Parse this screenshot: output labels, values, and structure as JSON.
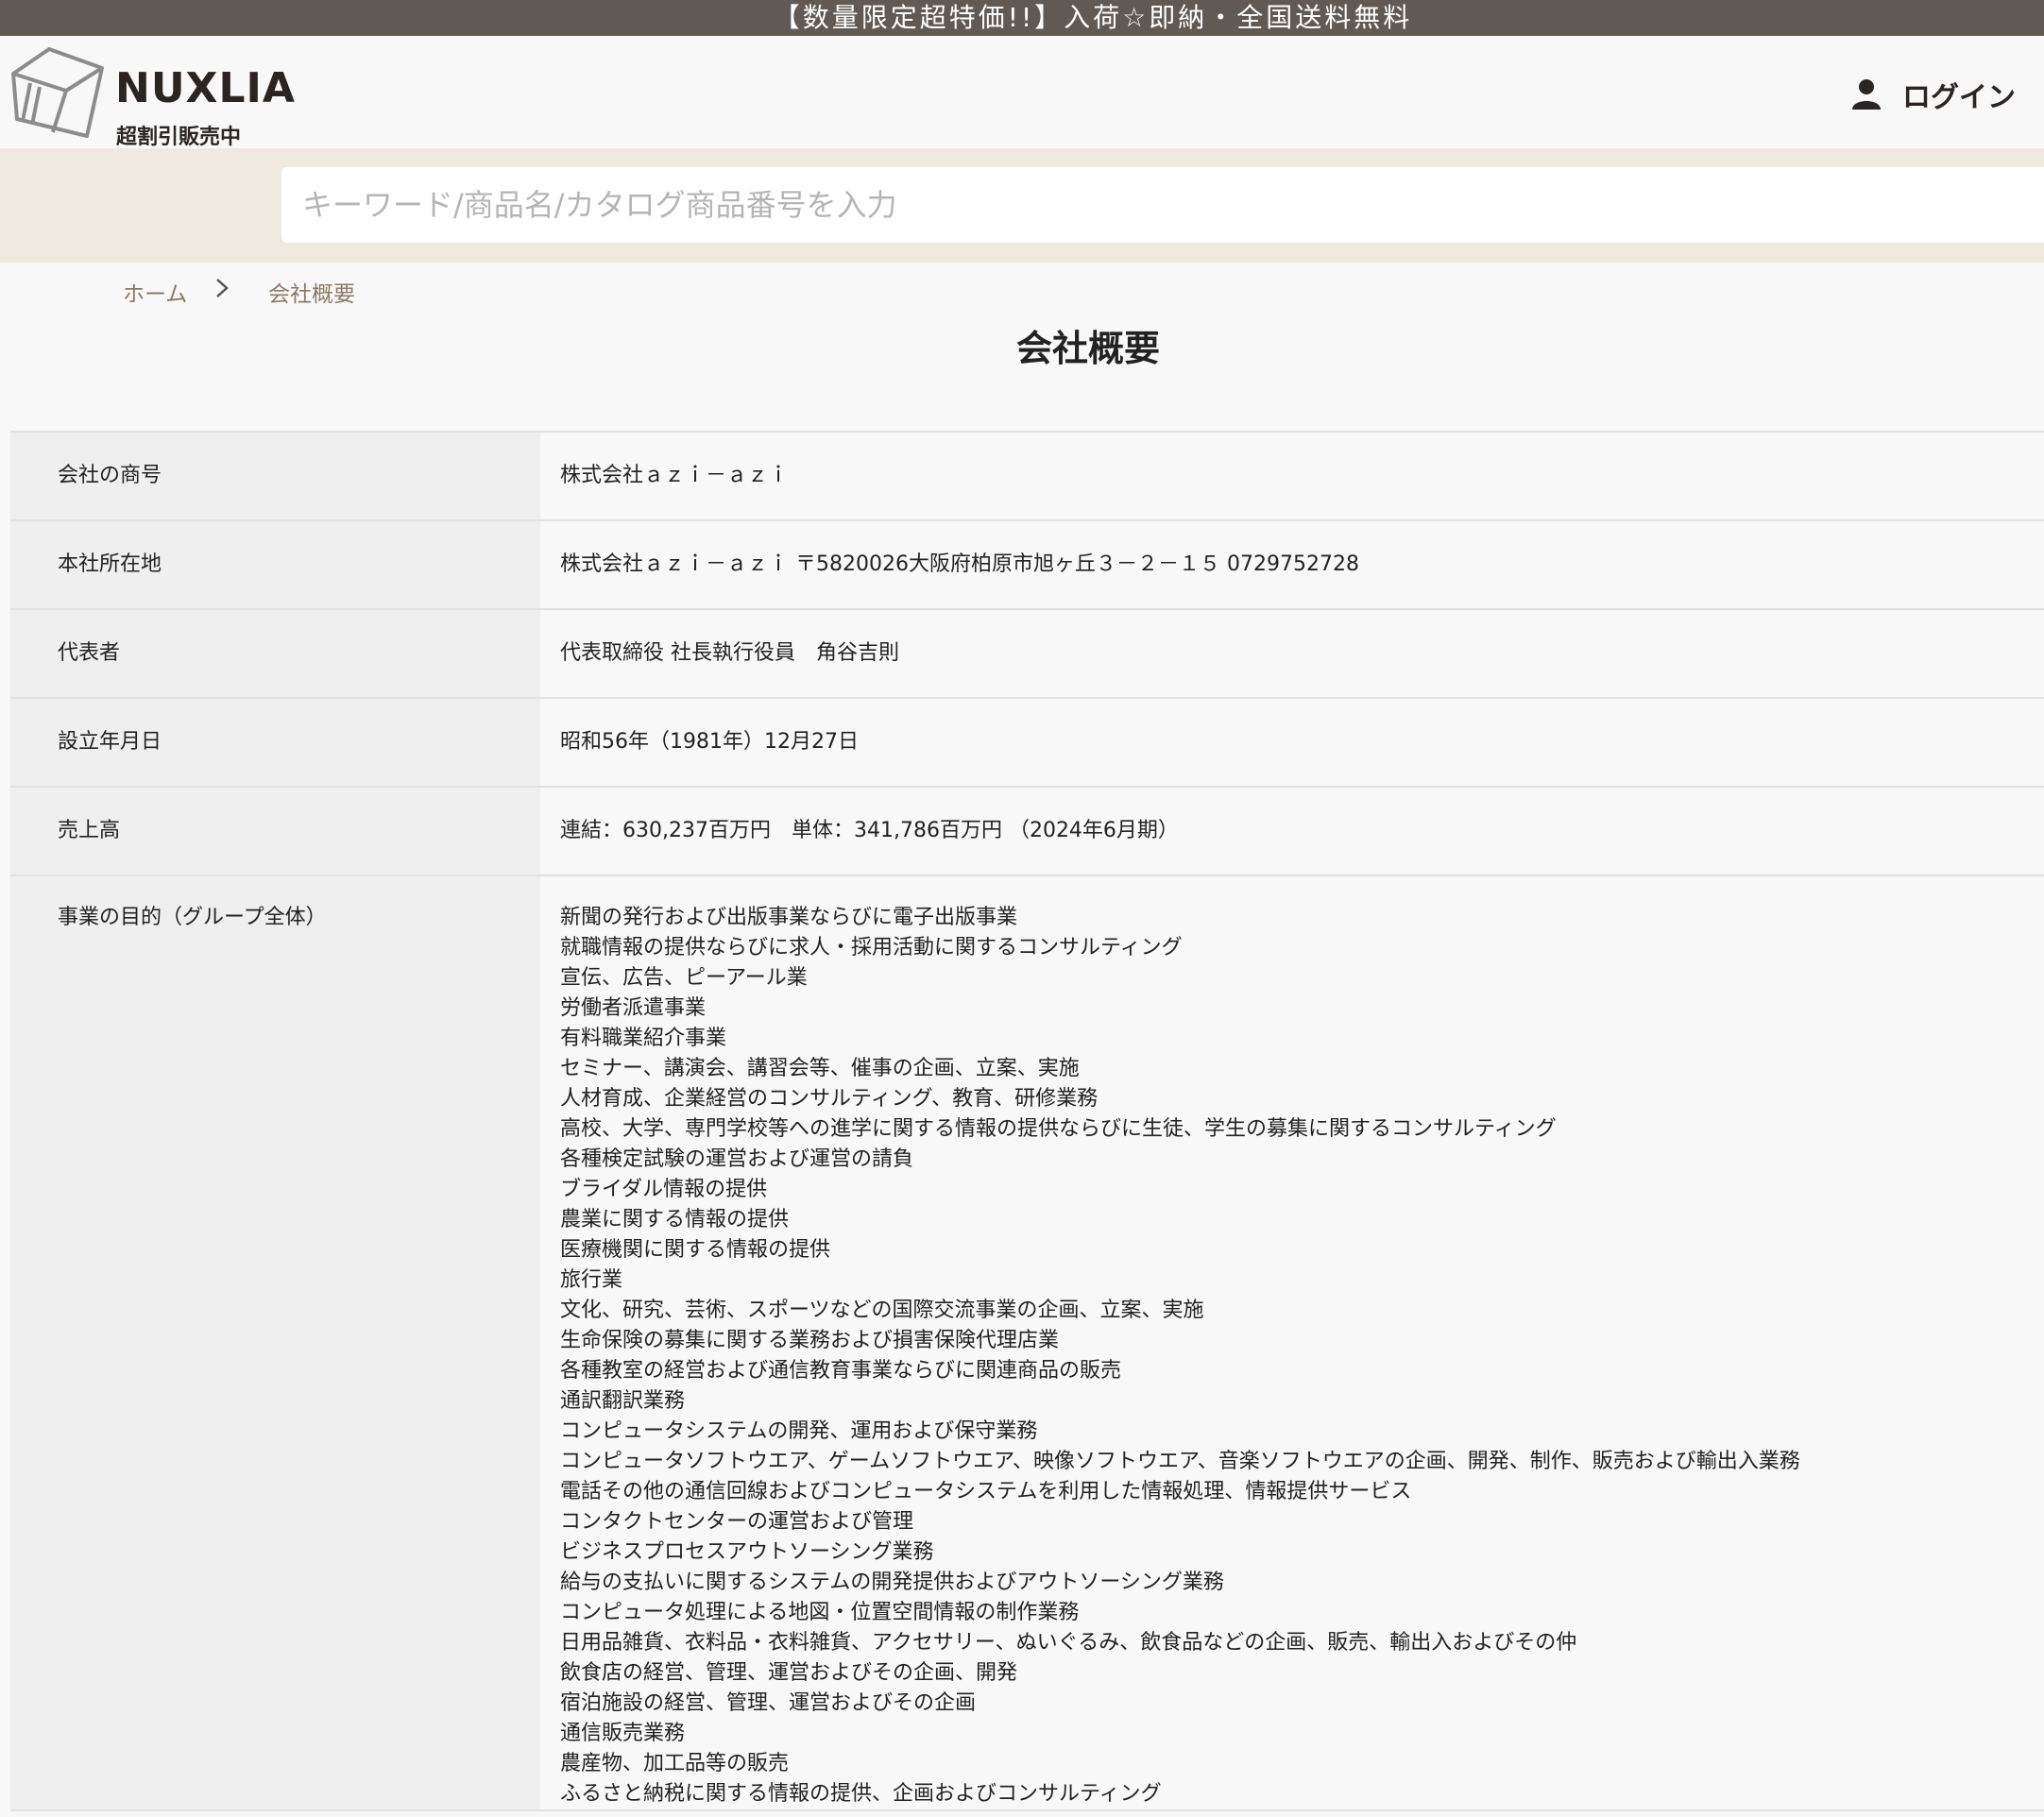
{
  "announcement": "【数量限定超特価!!】入荷☆即納・全国送料無料",
  "brand": {
    "name": "NUXLIA",
    "tagline": "超割引販売中"
  },
  "header": {
    "login_label": "ログイン"
  },
  "search": {
    "placeholder": "キーワード/商品名/カタログ商品番号を入力"
  },
  "breadcrumb": {
    "home": "ホーム",
    "separator": ">",
    "current": "会社概要"
  },
  "page_title": "会社概要",
  "company_table": [
    {
      "label": "会社の商号",
      "value": "株式会社ａｚｉ－ａｚｉ"
    },
    {
      "label": "本社所在地",
      "value": "株式会社ａｚｉ－ａｚｉ 〒5820026大阪府柏原市旭ヶ丘３－２－１５ 0729752728"
    },
    {
      "label": "代表者",
      "value": "代表取締役 社長執行役員　角谷吉則"
    },
    {
      "label": "設立年月日",
      "value": "昭和56年（1981年）12月27日"
    },
    {
      "label": "売上高",
      "value": "連結：630,237百万円　単体：341,786百万円 （2024年6月期）"
    }
  ],
  "business_purpose": {
    "label": "事業の目的（グループ全体）",
    "items": [
      "新聞の発行および出版事業ならびに電子出版事業",
      "就職情報の提供ならびに求人・採用活動に関するコンサルティング",
      "宣伝、広告、ピーアール業",
      "労働者派遣事業",
      "有料職業紹介事業",
      "セミナー、講演会、講習会等、催事の企画、立案、実施",
      "人材育成、企業経営のコンサルティング、教育、研修業務",
      "高校、大学、専門学校等への進学に関する情報の提供ならびに生徒、学生の募集に関するコンサルティング",
      "各種検定試験の運営および運営の請負",
      "ブライダル情報の提供",
      "農業に関する情報の提供",
      "医療機関に関する情報の提供",
      "旅行業",
      "文化、研究、芸術、スポーツなどの国際交流事業の企画、立案、実施",
      "生命保険の募集に関する業務および損害保険代理店業",
      "各種教室の経営および通信教育事業ならびに関連商品の販売",
      "通訳翻訳業務",
      "コンピュータシステムの開発、運用および保守業務",
      "コンピュータソフトウエア、ゲームソフトウエア、映像ソフトウエア、音楽ソフトウエアの企画、開発、制作、販売および輸出入業務",
      "電話その他の通信回線およびコンピュータシステムを利用した情報処理、情報提供サービス",
      "コンタクトセンターの運営および管理",
      "ビジネスプロセスアウトソーシング業務",
      "給与の支払いに関するシステムの開発提供およびアウトソーシング業務",
      "コンピュータ処理による地図・位置空間情報の制作業務",
      "日用品雑貨、衣料品・衣料雑貨、アクセサリー、ぬいぐるみ、飲食品などの企画、販売、輸出入およびその仲",
      "飲食店の経営、管理、運営およびその企画、開発",
      "宿泊施設の経営、管理、運営およびその企画",
      "通信販売業務",
      "農産物、加工品等の販売",
      "ふるさと納税に関する情報の提供、企画およびコンサルティング"
    ]
  }
}
